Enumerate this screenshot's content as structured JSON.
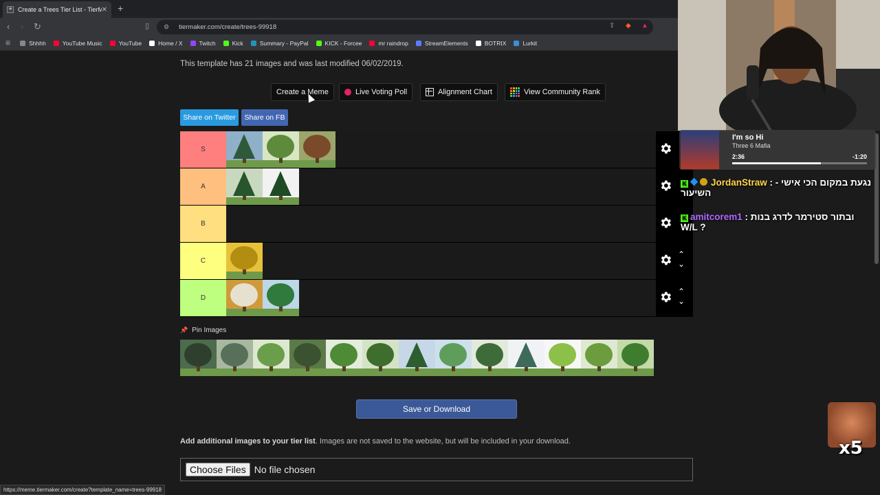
{
  "browser": {
    "tab_title": "Create a Trees Tier List - TierMa",
    "url": "tiermaker.com/create/trees-99918",
    "bookmarks": [
      {
        "label": "Shhhh",
        "color": "#888888"
      },
      {
        "label": "YouTube Music",
        "color": "#ff0033"
      },
      {
        "label": "YouTube",
        "color": "#ff0033"
      },
      {
        "label": "Home / X",
        "color": "#ffffff"
      },
      {
        "label": "Twitch",
        "color": "#9146ff"
      },
      {
        "label": "Kick",
        "color": "#53fc18"
      },
      {
        "label": "Summary - PayPal",
        "color": "#2790c3"
      },
      {
        "label": "KICK - Forcee",
        "color": "#53fc18"
      },
      {
        "label": "mr raindrop",
        "color": "#ff0033"
      },
      {
        "label": "StreamElements",
        "color": "#5a7cff"
      },
      {
        "label": "BOTRIX",
        "color": "#ffffff"
      },
      {
        "label": "Lurkit",
        "color": "#3a8fd9"
      }
    ],
    "status_url": "https://meme.tiermaker.com/create?template_name=trees-99918"
  },
  "page": {
    "template_info": "This template has 21 images and was last modified 06/02/2019.",
    "buttons": {
      "create_meme": "Create a Meme",
      "live_voting": "Live Voting Poll",
      "alignment_chart": "Alignment Chart",
      "community_rank": "View Community Rank"
    },
    "share_twitter": "Share on Twitter",
    "share_fb": "Share on FB",
    "tiers": [
      {
        "label": "S",
        "color": "#ff7f7f",
        "images": [
          "pine",
          "oak-wide",
          "redwood"
        ],
        "arrows": false
      },
      {
        "label": "A",
        "color": "#ffbf7f",
        "images": [
          "spruce",
          "fir"
        ],
        "arrows": false
      },
      {
        "label": "B",
        "color": "#ffdf7f",
        "images": [],
        "arrows": false
      },
      {
        "label": "C",
        "color": "#ffff7f",
        "images": [
          "aspen-yellow"
        ],
        "arrows": true
      },
      {
        "label": "D",
        "color": "#bfff7f",
        "images": [
          "birch-autumn",
          "round-tree"
        ],
        "arrows": true
      }
    ],
    "pin_images_label": "Pin Images",
    "pool_images": [
      "trunk",
      "willow-gray",
      "maple",
      "oak-big",
      "elm",
      "ash",
      "pine-field",
      "linden",
      "beech",
      "blue-spruce",
      "lime-tree",
      "weeping-willow",
      "hedge-tree"
    ],
    "save_button": "Save or Download",
    "add_images_bold": "Add additional images to your tier list",
    "add_images_text": ". Images are not saved to the website, but will be included in your download.",
    "choose_files": "Choose Files",
    "no_file": "No file chosen"
  },
  "overlay": {
    "now_playing": {
      "title": "I'm so Hi",
      "artist": "Three 6 Mafia",
      "elapsed": "2:36",
      "remaining": "-1:20",
      "progress": 0.66
    },
    "chat": [
      {
        "user": "JordanStraw",
        "user_color": "#ffd54a",
        "message": "נגעת במקום הכי אישי - השיעור"
      },
      {
        "user": "amitcorem1",
        "user_color": "#b26bff",
        "message": "ובתור סטירמר לדרג בנות W/L ?"
      }
    ],
    "emote_count": "x5"
  },
  "colors": {
    "twitter": "#2a9ae0",
    "facebook": "#4267b2",
    "save": "#3b5998"
  }
}
